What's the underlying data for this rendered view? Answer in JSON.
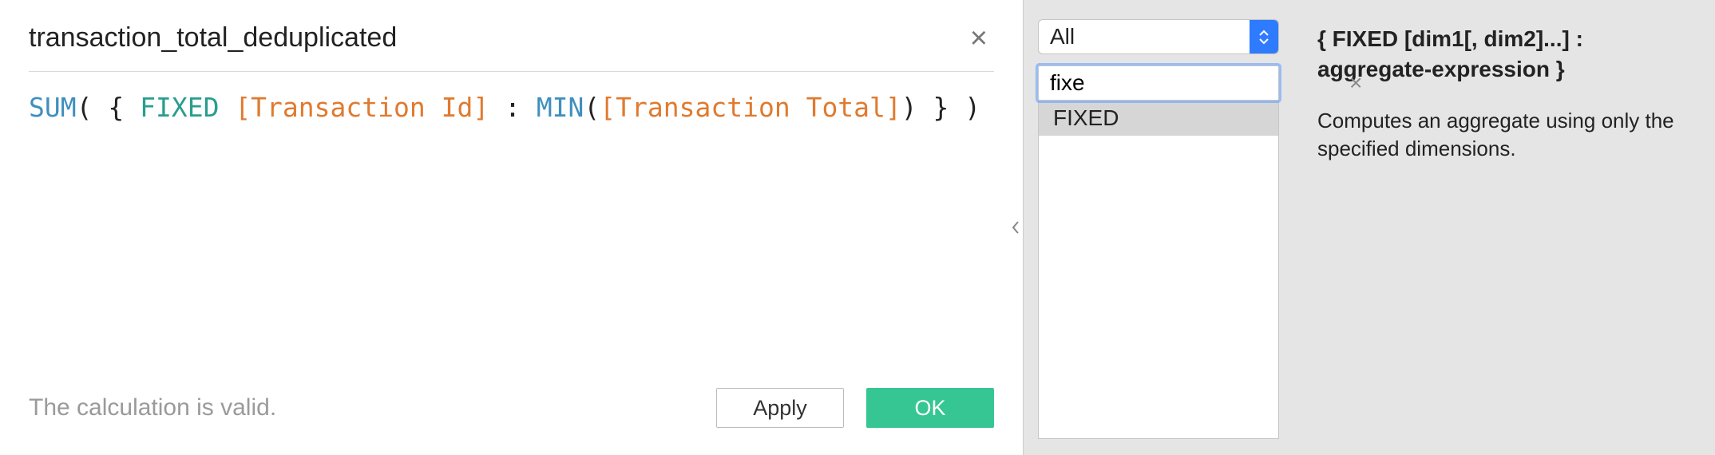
{
  "editor": {
    "name_value": "transaction_total_deduplicated",
    "close_glyph": "×",
    "formula": {
      "t1": "SUM",
      "t2": "( { ",
      "t3": "FIXED",
      "t4": " ",
      "t5": "[Transaction Id]",
      "t6": " : ",
      "t7": "MIN",
      "t8": "(",
      "t9": "[Transaction Total]",
      "t10": ") } )"
    },
    "status": "The calculation is valid.",
    "apply_label": "Apply",
    "ok_label": "OK"
  },
  "functions": {
    "category_selected": "All",
    "search_value": "fixe",
    "clear_glyph": "×",
    "results": {
      "0": {
        "label": "FIXED"
      }
    }
  },
  "help": {
    "title_line1": "{ FIXED [dim1[, dim2]...] :",
    "title_line2": "aggregate-expression }",
    "body": "Computes an aggregate using only the specified dimensions."
  }
}
